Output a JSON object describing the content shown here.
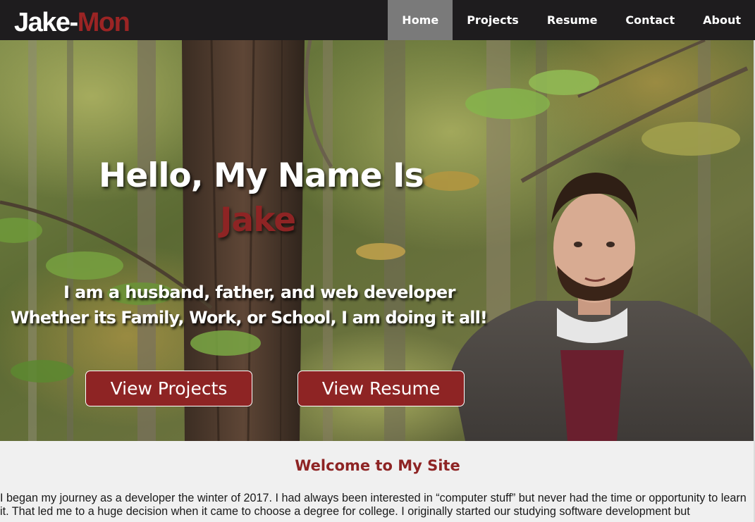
{
  "navbar": {
    "brand_part1": "Jake-",
    "brand_part2": "Mon",
    "links": [
      {
        "label": "Home",
        "active": true
      },
      {
        "label": "Projects",
        "active": false
      },
      {
        "label": "Resume",
        "active": false
      },
      {
        "label": "Contact",
        "active": false
      },
      {
        "label": "About",
        "active": false
      }
    ]
  },
  "hero": {
    "title": "Hello, My Name Is",
    "name": "Jake",
    "subtitle_line1": "I am a husband, father, and web developer",
    "subtitle_line2": "Whether its Family, Work, or School, I am doing it all!",
    "btn_projects": "View Projects",
    "btn_resume": "View Resume"
  },
  "content": {
    "heading": "Welcome to My Site",
    "intro": "I began my journey as a developer the winter of 2017. I had always been interested in “computer stuff” but never had the time or opportunity to learn it. That led me to a huge decision when it came to choose a degree for college. I originally started our studying software development but"
  },
  "colors": {
    "accent": "#8e2424",
    "nav_bg": "#1e1c1e",
    "nav_active": "#7a7a7a"
  },
  "icons": [
    "hero-photo"
  ]
}
